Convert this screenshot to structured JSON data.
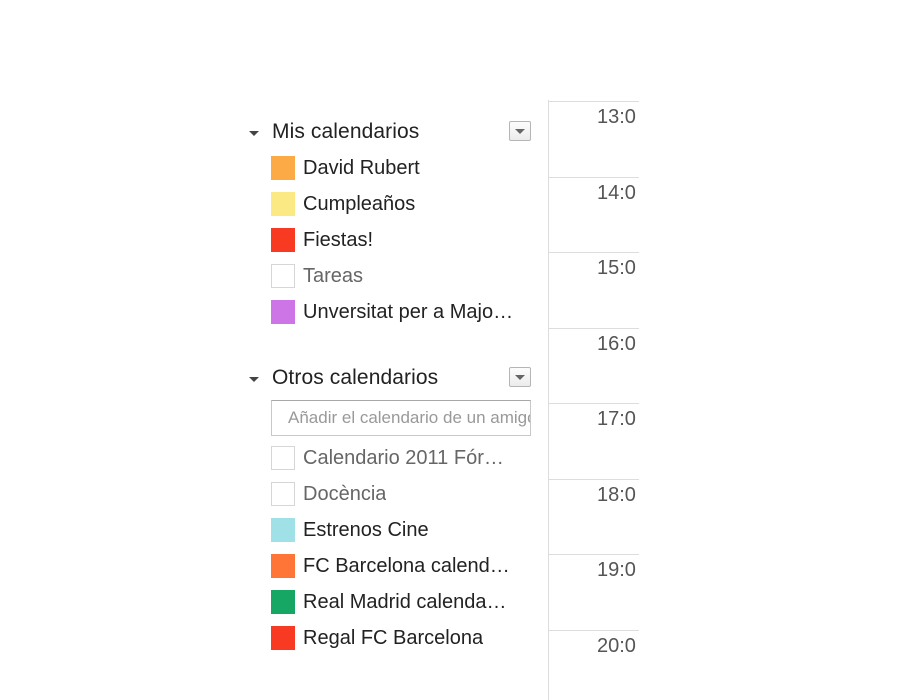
{
  "my_calendars": {
    "title": "Mis calendarios",
    "items": [
      {
        "name": "David Rubert",
        "color": "#fbaa45",
        "checked": true
      },
      {
        "name": "Cumpleaños",
        "color": "#fbe983",
        "checked": true
      },
      {
        "name": "Fiestas!",
        "color": "#f83a22",
        "checked": true
      },
      {
        "name": "Tareas",
        "color": "",
        "checked": false
      },
      {
        "name": "Unversitat per a Majo…",
        "color": "#cd74e6",
        "checked": true
      }
    ]
  },
  "other_calendars": {
    "title": "Otros calendarios",
    "add_placeholder": "Añadir el calendario de un amigo",
    "items": [
      {
        "name": "Calendario 2011 Fór…",
        "color": "",
        "checked": false
      },
      {
        "name": "Docència",
        "color": "",
        "checked": false
      },
      {
        "name": "Estrenos Cine",
        "color": "#9fe1e7",
        "checked": true
      },
      {
        "name": "FC Barcelona calend…",
        "color": "#ff7537",
        "checked": true
      },
      {
        "name": "Real Madrid calenda…",
        "color": "#16a765",
        "checked": true
      },
      {
        "name": "Regal FC Barcelona",
        "color": "#f83a22",
        "checked": true
      }
    ]
  },
  "time_labels": [
    "13:0",
    "14:0",
    "15:0",
    "16:0",
    "17:0",
    "18:0",
    "19:0",
    "20:0"
  ]
}
